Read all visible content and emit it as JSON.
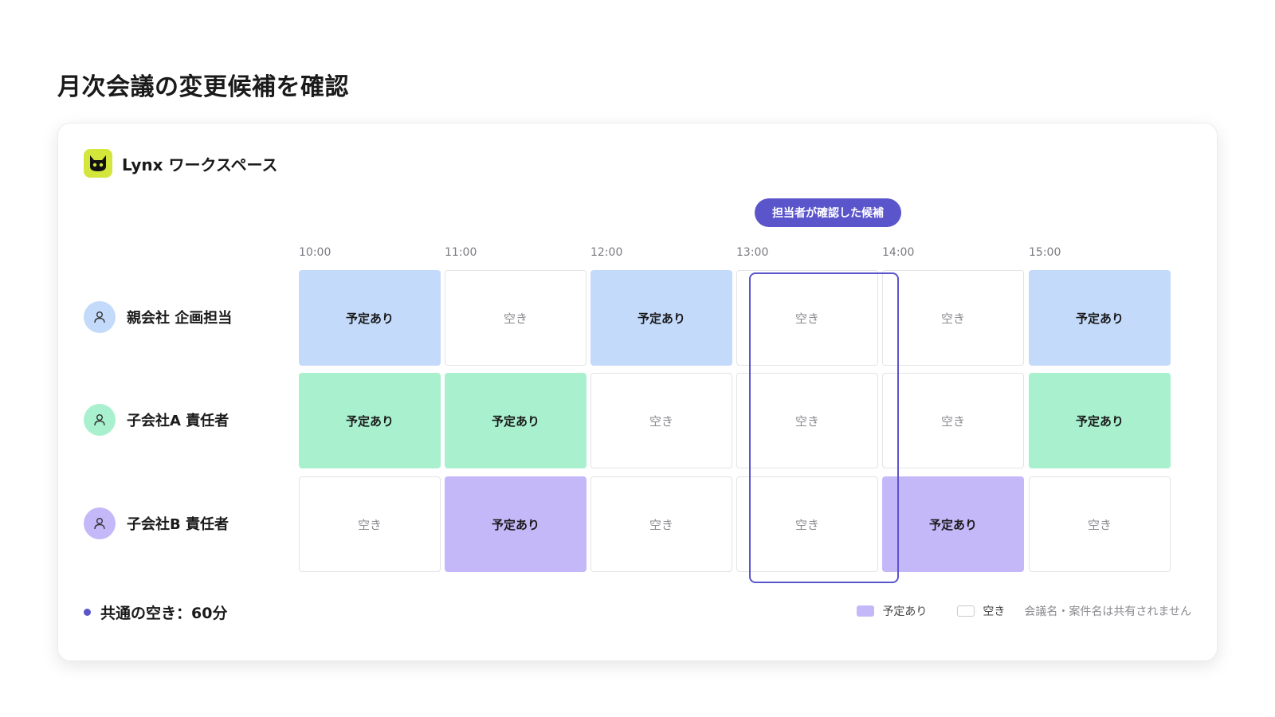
{
  "page_title": "月次会議の変更候補を確認",
  "workspace": {
    "name": "Lynx ワークスペース",
    "logo_icon": "lynx-cat-icon",
    "logo_color": "#d4e63b"
  },
  "candidate_badge": "担当者が確認した候補",
  "times": [
    "10:00",
    "11:00",
    "12:00",
    "13:00",
    "14:00",
    "15:00"
  ],
  "highlighted_time_index": 3,
  "rows": [
    {
      "name": "親会社 企画担当",
      "avatar_color": "#c4dafb",
      "busy_color": "#c4dafb",
      "cells": [
        "予定あり",
        "空き",
        "予定あり",
        "空き",
        "空き",
        "予定あり"
      ],
      "busy": [
        true,
        false,
        true,
        false,
        false,
        true
      ]
    },
    {
      "name": "子会社A 責任者",
      "avatar_color": "#a9f0cf",
      "busy_color": "#a9f0cf",
      "cells": [
        "予定あり",
        "予定あり",
        "空き",
        "空き",
        "空き",
        "予定あり"
      ],
      "busy": [
        true,
        true,
        false,
        false,
        false,
        true
      ]
    },
    {
      "name": "子会社B 責任者",
      "avatar_color": "#c4b8f9",
      "busy_color": "#c4b8f9",
      "cells": [
        "空き",
        "予定あり",
        "空き",
        "空き",
        "予定あり",
        "空き"
      ],
      "busy": [
        false,
        true,
        false,
        false,
        true,
        false
      ]
    }
  ],
  "common_free": "共通の空き：60分",
  "legend": {
    "busy_label": "予定あり",
    "free_label": "空き",
    "note": "会議名・案件名は共有されません"
  },
  "accent_color": "#5b55cc"
}
